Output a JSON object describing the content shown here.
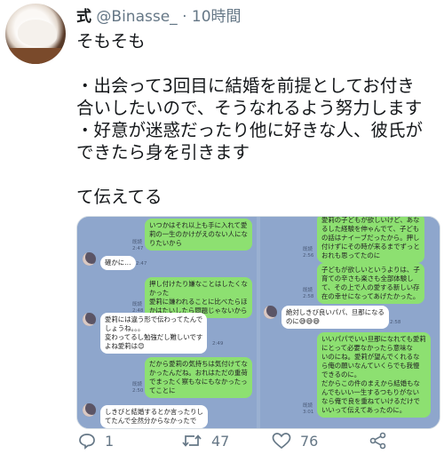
{
  "tweet": {
    "display_name": "式",
    "handle": "@Binasse_",
    "separator": "·",
    "time": "10時間",
    "lines": [
      "そもそも",
      "",
      "・出会って3回目に結婚を前提としてお付き",
      "合いしたいので、そうなれるよう努力します",
      "・好意が迷惑だったり他に好きな人、彼氏が",
      "できたら身を引きます",
      "",
      "て伝えてる"
    ]
  },
  "screenshot_left": {
    "messages": [
      {
        "kind": "out",
        "text": "いつかはそれ以上も手に入れて愛\n莉の一生のかけがえのない人にな\nりたいから"
      },
      {
        "kind": "time",
        "text": "既読\n2:47"
      },
      {
        "kind": "in",
        "text": "確かに…"
      },
      {
        "kind": "time",
        "text": "2:47"
      },
      {
        "kind": "out",
        "text": "押し付けたり嫌なことはしたくな\nかった\n愛莉に嫌われることに比べたらほ\nかはたいしたら問題じゃないから"
      },
      {
        "kind": "time",
        "text": "既読\n2:48"
      },
      {
        "kind": "in",
        "text": "愛莉には違う形で伝わってたんで\nしょうね。。。\n変わってるし勉強だし難しいです\nよね愛莉は😊"
      },
      {
        "kind": "time",
        "text": "2:49"
      },
      {
        "kind": "out",
        "text": "だから愛莉の気持ちは気付けてな\nかったんだね。おれはただの重荷\nでまったく察もなにもなかったっ\nてことに"
      },
      {
        "kind": "time",
        "text": "既読\n2:50"
      },
      {
        "kind": "in",
        "text": "しきびと結婚するとか言ったりし\nてたんで全然分からなかったで"
      }
    ]
  },
  "screenshot_right": {
    "messages": [
      {
        "kind": "out",
        "text": "愛莉の子どもが欲しいけど、あな\nるした経験を伸ゃんでて、子ども\nの話はナイーブだったから。押し\n付けずにその時が来るまでずっと\nおれも思ってたのに"
      },
      {
        "kind": "time",
        "text": "既読\n2:56"
      },
      {
        "kind": "out",
        "text": "子どもが欲しいというよりは、子\n育ての辛さも楽さも全部体験し\nて、その上で人の愛する新しい存\n在の幸せになってあげたかった。"
      },
      {
        "kind": "time",
        "text": "既読\n2:58"
      },
      {
        "kind": "in",
        "text": "絶対しきび良いパパ、旦那になる\nのに😅😅😅"
      },
      {
        "kind": "time",
        "text": "2:58"
      },
      {
        "kind": "out",
        "text": "いいパパでいい旦那になれても愛莉\nにとって必要なかったら意味な\nいのにね。愛莉が望んでくれるな\nら俺の願いなんていくらでも我慢\nできるのに。\nだからこの件のまえから結婚もな\nんでもいい一生するつもりがない\nなら俺で良を重ねていけるだけで\nいいって伝えてあったのに。"
      },
      {
        "kind": "time",
        "text": "既読\n3:01"
      }
    ]
  },
  "actions": {
    "reply_count": "1",
    "retweet_count": "47",
    "like_count": "76"
  },
  "icons": [
    "reply-icon",
    "retweet-icon",
    "like-icon",
    "share-icon"
  ],
  "colors": {
    "text": "#14171a",
    "secondary": "#657786",
    "line_green": "#8de071",
    "line_bg": "#8ea6cc"
  }
}
